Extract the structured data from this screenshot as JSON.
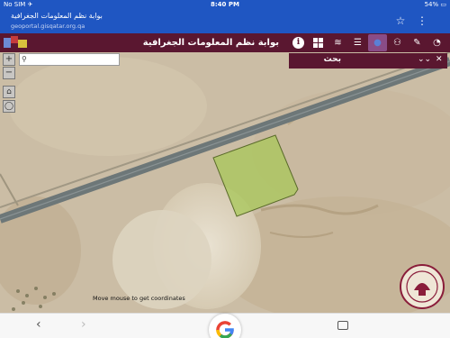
{
  "status_bar": {
    "carrier": "No SIM ✈",
    "time": "8:40 PM",
    "battery": "54%"
  },
  "browser": {
    "page_title": "بوابة نظم المعلومات الجغرافية",
    "url": "geoportal.gisqatar.org.qa"
  },
  "app": {
    "title": "بوابة نظم المعلومات الجغرافية",
    "tools": [
      {
        "icon": "info-icon",
        "label": "i"
      },
      {
        "icon": "grid-icon",
        "label": ""
      },
      {
        "icon": "layers-icon",
        "label": "≋"
      },
      {
        "icon": "list-icon",
        "label": "☰"
      },
      {
        "icon": "globe-icon",
        "label": "●"
      },
      {
        "icon": "network-icon",
        "label": "⚇"
      },
      {
        "icon": "draw-icon",
        "label": "✎"
      },
      {
        "icon": "share-icon",
        "label": "◔"
      },
      {
        "icon": "hand-icon",
        "label": "✋"
      }
    ]
  },
  "map": {
    "search_placeholder": "",
    "zoom_in": "+",
    "zoom_out": "−",
    "coord_hint": "Move mouse to get coordinates",
    "parcel_color": "#a8c85a"
  },
  "search_panel": {
    "title": "بحث",
    "collapse": "⌄⌄",
    "close": "✕"
  },
  "bottom_bar": {
    "back": "‹",
    "forward": "›"
  }
}
